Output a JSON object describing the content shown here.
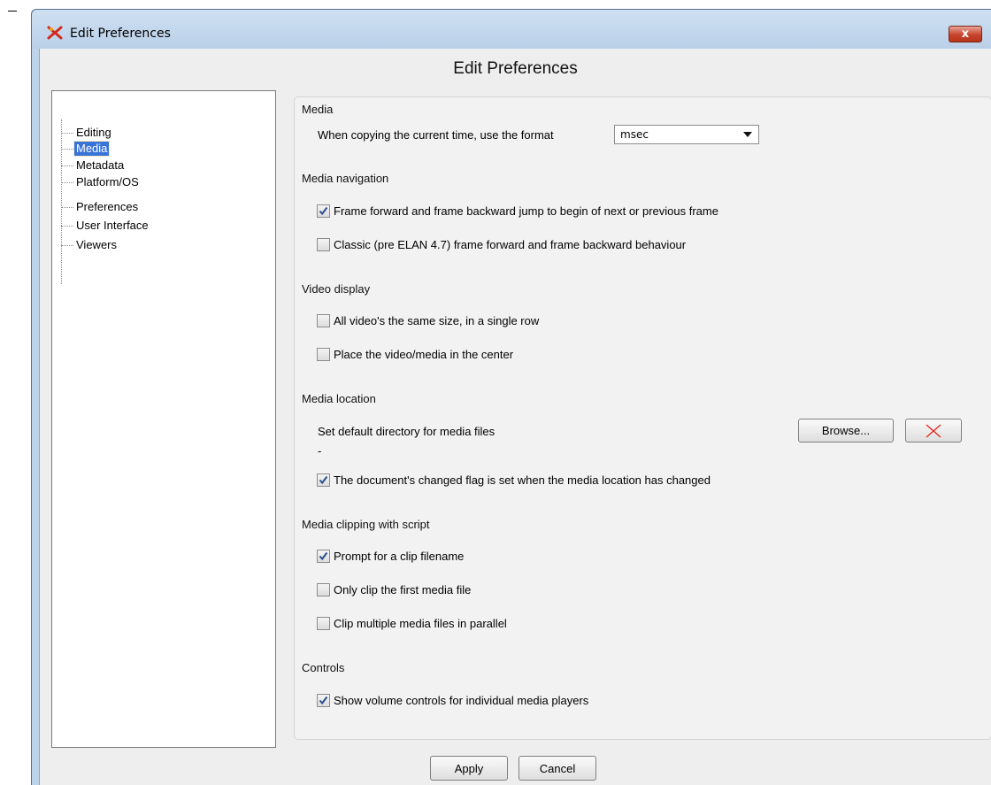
{
  "window": {
    "title": "Edit Preferences",
    "close_glyph": "x",
    "app_icon": "elan-app-icon"
  },
  "dialog": {
    "heading": "Edit Preferences"
  },
  "tree": {
    "items": [
      {
        "label": "Editing",
        "selected": false
      },
      {
        "label": "Media",
        "selected": true
      },
      {
        "label": "Metadata",
        "selected": false
      },
      {
        "label": "Platform/OS",
        "selected": false
      },
      {
        "label": "Preferences",
        "selected": false
      },
      {
        "label": "User Interface",
        "selected": false
      },
      {
        "label": "Viewers",
        "selected": false
      }
    ]
  },
  "media": {
    "heading": "Media",
    "time_format_label": "When copying the current time, use the format",
    "time_format_value": "msec"
  },
  "navigation": {
    "heading": "Media navigation",
    "options": [
      {
        "label": "Frame forward and frame backward jump to begin of next or previous frame",
        "checked": true
      },
      {
        "label": "Classic (pre ELAN 4.7) frame forward and frame backward behaviour",
        "checked": false
      }
    ]
  },
  "video": {
    "heading": "Video display",
    "options": [
      {
        "label": "All video's the same size, in a single row",
        "checked": false
      },
      {
        "label": "Place the video/media in the center",
        "checked": false
      }
    ]
  },
  "location": {
    "heading": "Media location",
    "dir_label": "Set default directory for media files",
    "dir_value": "-",
    "browse_label": "Browse...",
    "clear_icon": "red-x-icon",
    "changed_flag": {
      "label": "The document's changed flag is set when the media location has changed",
      "checked": true
    }
  },
  "clipping": {
    "heading": "Media clipping with script",
    "options": [
      {
        "label": "Prompt for a clip filename",
        "checked": true
      },
      {
        "label": "Only clip the first media file",
        "checked": false
      },
      {
        "label": "Clip multiple media files in parallel",
        "checked": false
      }
    ]
  },
  "controls": {
    "heading": "Controls",
    "options": [
      {
        "label": "Show volume controls for individual media players",
        "checked": true
      }
    ]
  },
  "footer": {
    "apply_label": "Apply",
    "cancel_label": "Cancel"
  },
  "colors": {
    "selection": "#3874d8",
    "close_button": "#c7452d",
    "titlebar": "#bcd3ea"
  }
}
